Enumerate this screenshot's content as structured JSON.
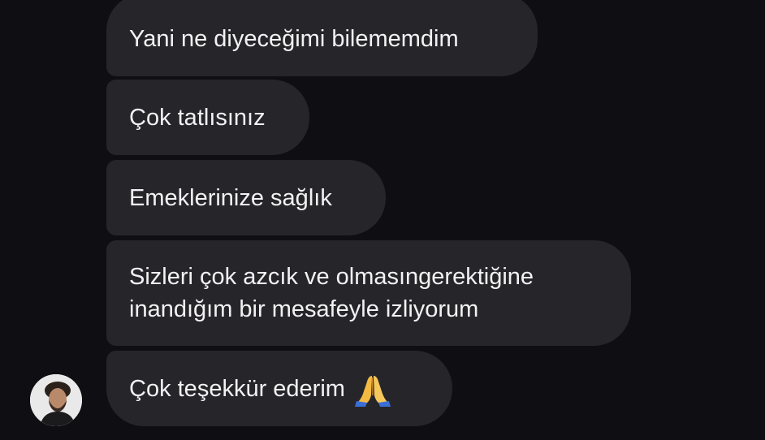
{
  "messages": [
    {
      "text": "Yani ne diyeceğimi bilememdim"
    },
    {
      "text": "Çok tatlısınız"
    },
    {
      "text": "Emeklerinize sağlık"
    },
    {
      "text": "Sizleri çok azcık ve olmasıngerektiğine inandığım bir mesafeyle izliyorum"
    },
    {
      "text": "Çok teşekkür ederim",
      "emoji": "folded-hands-icon"
    }
  ],
  "colors": {
    "background": "#0f0f13",
    "bubble": "#26262a",
    "text": "#f2f2f4"
  }
}
